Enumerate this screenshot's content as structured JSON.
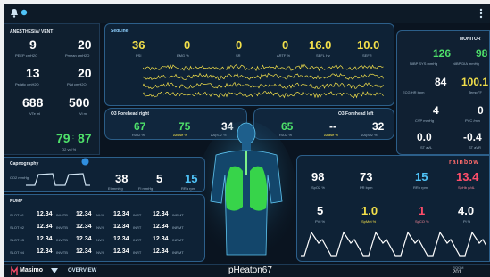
{
  "anesthesia": {
    "title": "ANESTHESIA/ VENT",
    "peep": {
      "value": "9",
      "label": "PEEP cmH2O"
    },
    "pmean": {
      "value": "20",
      "label": "Pmean cmH2O"
    },
    "pstatic": {
      "value": "13",
      "label": "Pstatic cmH2O"
    },
    "pplat": {
      "value": "20",
      "label": "Plat cmH2O"
    },
    "vte": {
      "value": "688",
      "label": "VTe ml"
    },
    "vi": {
      "value": "500",
      "label": "Vi ml"
    },
    "o2_green1": "79",
    "o2_green2": "87",
    "o2_label": "O2 vol %"
  },
  "sedline": {
    "title": "SedLine",
    "psi": {
      "value": "36",
      "label": "PSI"
    },
    "emg": {
      "value": "0",
      "label": "EMG %"
    },
    "sr": {
      "value": "0",
      "label": "SR"
    },
    "artf": {
      "value": "0",
      "label": "ARTF %"
    },
    "sefl": {
      "value": "16.0",
      "label": "SEFL Hz"
    },
    "sefr": {
      "value": "10.0",
      "label": "SEFR"
    }
  },
  "o3_right": {
    "title": "O3 Forehead right",
    "rso2": {
      "value": "67",
      "label": "rSO2 %"
    },
    "delta_base": {
      "value": "75",
      "label": "Δbase %"
    },
    "delta_spo2": {
      "value": "34",
      "label": "ΔSpO2 %"
    }
  },
  "o3_left": {
    "title": "O3 Forehead left",
    "rso2": {
      "value": "65",
      "label": "rSO2 %"
    },
    "delta_base": {
      "value": "--",
      "label": "Δbase %"
    },
    "delta_spo2": {
      "value": "32",
      "label": "ΔSpO2 %"
    }
  },
  "monitor": {
    "title": "MONITOR",
    "nibp_sys": {
      "value": "126",
      "label": "NIBP SYS mmHg"
    },
    "nibp_dia": {
      "value": "98",
      "label": "NIBP DIA mmHg"
    },
    "ecg_hr": {
      "value": "84",
      "label": "ECG HR bpm"
    },
    "temp": {
      "value": "100.1",
      "label": "Temp °F"
    },
    "cvp": {
      "value": "4",
      "label": "CVP mmHg"
    },
    "pvc": {
      "value": "0",
      "label": "PVC /min"
    },
    "st_avl": {
      "value": "0.0",
      "label": "ST aVL"
    },
    "st_avr": {
      "value": "-0.4",
      "label": "ST aVR"
    }
  },
  "capnography": {
    "title": "Capnography",
    "etco2": {
      "value": "38",
      "label": "Et mmHg"
    },
    "fico2": {
      "value": "5",
      "label": "Fi mmHg"
    },
    "rr": {
      "value": "15",
      "label": "RRa rpm"
    },
    "wave_label": "CO2 mmHg"
  },
  "rainbow": {
    "title": "rainbow",
    "spo2": {
      "value": "98",
      "label": "SpO2 %"
    },
    "pr": {
      "value": "73",
      "label": "PR bpm"
    },
    "rrp": {
      "value": "15",
      "label": "RRp rpm"
    },
    "sphb": {
      "value": "13.4",
      "label": "SpHb g/dL"
    },
    "pvi": {
      "value": "5",
      "label": "PVI %"
    },
    "spmet": {
      "value": "1.0",
      "label": "SpMet %"
    },
    "spco": {
      "value": "1",
      "label": "SpCO %"
    },
    "pi": {
      "value": "4.0",
      "label": "Pi %"
    }
  },
  "pump": {
    "title": "PUMP",
    "rows": [
      {
        "slot": "SLOT 01",
        "c1": "12.34",
        "u1": "INV/TB",
        "c2": "12.34",
        "u2": "INV/I",
        "c3": "12.34",
        "u3": "INRT",
        "c4": "12.34",
        "u4": "INRMT"
      },
      {
        "slot": "SLOT 02",
        "c1": "12.34",
        "u1": "INV/TB",
        "c2": "12.34",
        "u2": "INV/I",
        "c3": "12.34",
        "u3": "INRT",
        "c4": "12.34",
        "u4": "INRMT"
      },
      {
        "slot": "SLOT 03",
        "c1": "12.34",
        "u1": "INV/TB",
        "c2": "12.34",
        "u2": "INV/I",
        "c3": "12.34",
        "u3": "INRT",
        "c4": "12.34",
        "u4": "INRMT"
      },
      {
        "slot": "SLOT 04",
        "c1": "12.34",
        "u1": "INV/TB",
        "c2": "12.34",
        "u2": "INV/I",
        "c3": "12.34",
        "u3": "INRT",
        "c4": "12.34",
        "u4": "INRMT"
      }
    ]
  },
  "bottom": {
    "brand": "Masimo",
    "view": "OVERVIEW",
    "patient": "pHeaton67",
    "room_label": "ROOM",
    "room": "201"
  },
  "colors": {
    "accent": "#4fc3f7",
    "sedline_yellow": "#f3e04a",
    "o3_green": "#4ee06a",
    "alarm_red": "#ff4d6a",
    "background": "#0a1420"
  }
}
